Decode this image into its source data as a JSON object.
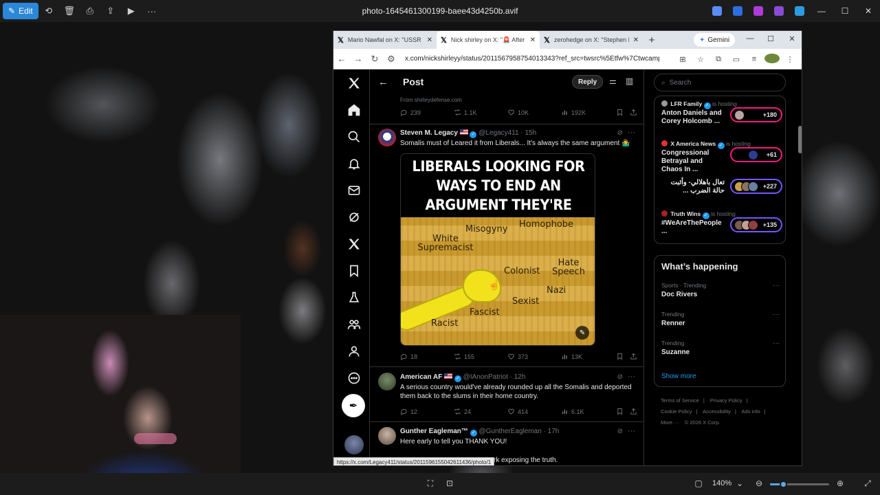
{
  "viewer": {
    "edit_label": "Edit",
    "file_title": "photo-1645461300199-baee43d4250b.avif",
    "zoom_label": "140%",
    "zoom_fraction": 0.22
  },
  "browser": {
    "tabs": [
      {
        "title": "Mario Nawfal on X: \"USSR TRU",
        "active": false
      },
      {
        "title": "Nick shirley on X: \"🚨 After m",
        "active": true
      },
      {
        "title": "zerohedge on X: \"Stephen M",
        "active": false
      }
    ],
    "gemini_label": "Gemini",
    "url": "x.com/nickshirleyy/status/2011567958754013343?ref_src=twsrc%5Etfw%7Ctwcamp%5Et..."
  },
  "timeline": {
    "header_title": "Post",
    "reply_label": "Reply",
    "from_line": "From shirleydefense.com",
    "top_actions": {
      "replies": "239",
      "reposts": "1.1K",
      "likes": "10K",
      "views": "192K"
    },
    "tweets": [
      {
        "name": "Steven M. Legacy",
        "handle": "@Legacy411 · 15h",
        "text": "Somalis must of Leared it from Liberals... It's always the same argument 🤷‍♂️",
        "actions": {
          "replies": "18",
          "reposts": "155",
          "likes": "373",
          "views": "13K"
        }
      },
      {
        "name": "American AF",
        "handle": "@IAnonPatriot · 12h",
        "text": "A serious country would've already rounded up all the Somalis and deported them back to the slums in their home country.",
        "actions": {
          "replies": "12",
          "reposts": "24",
          "likes": "414",
          "views": "6.1K"
        }
      },
      {
        "name": "Gunther Eagleman™",
        "handle": "@GuntherEagleman · 17h",
        "text": "Here early to tell you THANK YOU!",
        "text2": "rk exposing the truth."
      }
    ],
    "meme": {
      "caption": "LIBERALS LOOKING FOR WAYS TO END AN ARGUMENT THEY'RE LOSING:",
      "cards": [
        "Misogyny",
        "Homophobe",
        "White Supremacist",
        "Colonist",
        "Hate Speech",
        "Nazi",
        "Sexist",
        "Fascist",
        "Racist"
      ]
    },
    "status_url": "https://x.com/Legacy411/status/2011596155042611436/photo/1"
  },
  "sidebar": {
    "search_placeholder": "Search",
    "live": [
      {
        "host": "LFR Family",
        "hosting": "is hosting",
        "title": "Anton Daniels and Corey Holcomb ...",
        "count": "+180",
        "pill_color": "#f91880"
      },
      {
        "host": "X America News",
        "hosting": "is hosting",
        "title": "Congressional Betrayal and Chaos In ...",
        "count": "+61",
        "pill_color": "#f91880"
      },
      {
        "host": "",
        "hosting": "",
        "title": "تعال باهلالي- وأثبت حالة الضرب ...",
        "count": "+227",
        "pill_color": "#7856ff"
      },
      {
        "host": "Truth Wins",
        "hosting": "is hosting",
        "title": "#WeAreThePeople ...",
        "count": "+135",
        "pill_color": "#7856ff"
      }
    ],
    "happening_title": "What’s happening",
    "trends": [
      {
        "category": "Sports · Trending",
        "name": "Doc Rivers"
      },
      {
        "category": "Trending",
        "name": "Renner"
      },
      {
        "category": "Trending",
        "name": "Suzanne"
      }
    ],
    "show_more": "Show more",
    "footer": [
      "Terms of Service",
      "|",
      "Privacy Policy",
      "|",
      "Cookie Policy",
      "|",
      "Accessibility",
      "|",
      "Ads info",
      "|",
      "More ···",
      "© 2026 X Corp."
    ]
  }
}
